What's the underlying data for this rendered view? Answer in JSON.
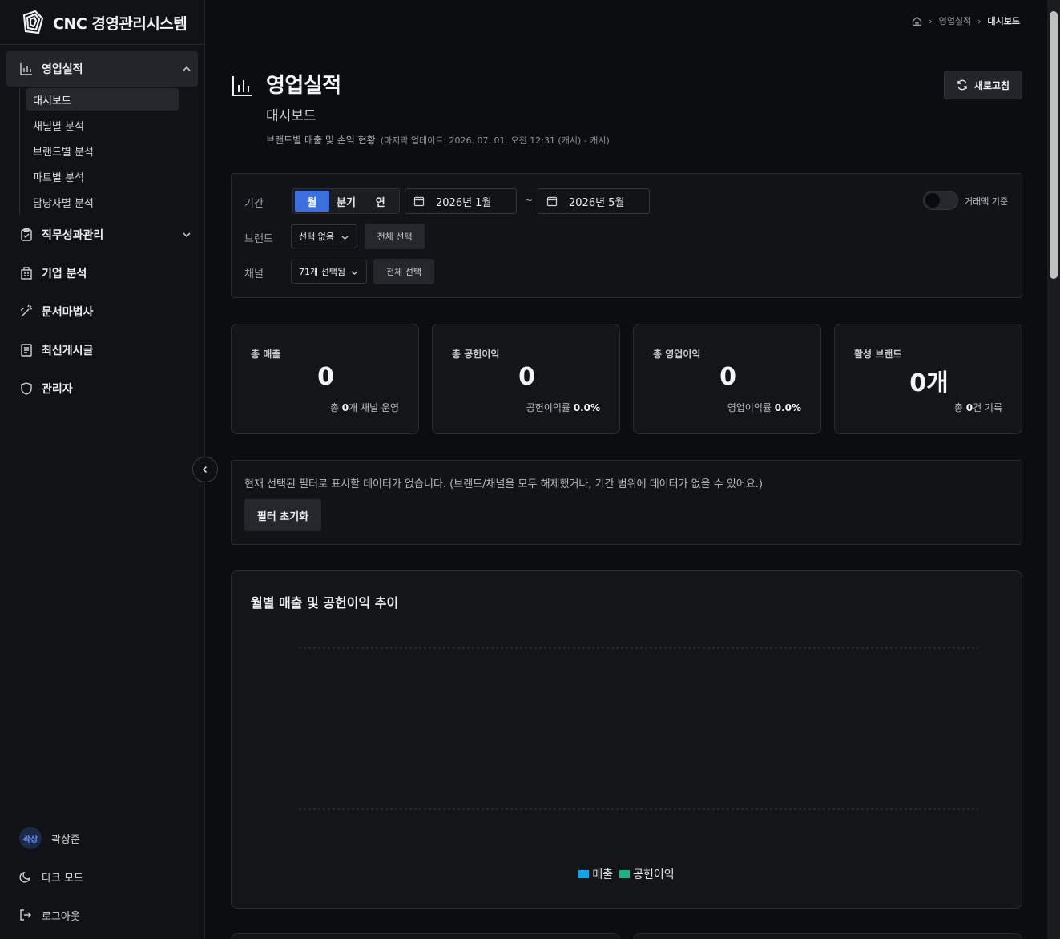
{
  "app": {
    "title": "CNC 경영관리시스템"
  },
  "sidebar": {
    "groups": [
      {
        "label": "영업실적",
        "icon": "bar-chart-icon"
      },
      {
        "label": "직무성과관리",
        "icon": "clipboard-icon"
      },
      {
        "label": "기업 분석",
        "icon": "building-icon"
      },
      {
        "label": "문서마법사",
        "icon": "magic-wand-icon"
      },
      {
        "label": "최신게시글",
        "icon": "newspaper-icon"
      },
      {
        "label": "관리자",
        "icon": "shield-icon"
      }
    ],
    "sub_items": [
      "대시보드",
      "채널별 분석",
      "브랜드별 분석",
      "파트별 분석",
      "담당자별 분석"
    ],
    "user": {
      "avatar": "곽상",
      "name": "곽상준"
    },
    "dark_mode": "다크 모드",
    "logout": "로그아웃"
  },
  "breadcrumb": {
    "parent": "영업실적",
    "current": "대시보드"
  },
  "page": {
    "title": "영업실적",
    "subtitle": "대시보드",
    "description": "브랜드별 매출 및 손익 현황",
    "meta": "(마지막 업데이트: 2026. 07. 01. 오전 12:31 (캐시) - 캐시)",
    "refresh": "새로고침"
  },
  "filters": {
    "period_label": "기간",
    "period_options": [
      "월",
      "분기",
      "연"
    ],
    "period_selected": "월",
    "start": "2026년 1월",
    "tilde": "~",
    "end": "2026년 5월",
    "toggle_label": "거래액 기준",
    "toggle_on": false,
    "brand_label": "브랜드",
    "brand_value": "선택 없음",
    "brand_select_all": "전체 선택",
    "channel_label": "채널",
    "channel_value": "71개 선택됨",
    "channel_select_all": "전체 선택"
  },
  "stats": [
    {
      "label": "총 매출",
      "value": "0",
      "foot_pre": "총 ",
      "foot_bold": "0",
      "foot_post": "개 채널 운영"
    },
    {
      "label": "총 공헌이익",
      "value": "0",
      "foot_pre": "공헌이익률 ",
      "foot_bold": "0.0%",
      "foot_post": ""
    },
    {
      "label": "총 영업이익",
      "value": "0",
      "foot_pre": "영업이익률 ",
      "foot_bold": "0.0%",
      "foot_post": ""
    },
    {
      "label": "활성 브랜드",
      "value": "0개",
      "foot_pre": "총 ",
      "foot_bold": "0",
      "foot_post": "건 기록"
    }
  ],
  "notice": {
    "text": "현재 선택된 필터로 표시할 데이터가 없습니다. (브랜드/채널을 모두 해제했거나, 기간 범위에 데이터가 없을 수 있어요.)",
    "reset": "필터 초기화"
  },
  "chart": {
    "title": "월별 매출 및 공헌이익 추이",
    "legend": [
      {
        "name": "매출",
        "color": "#0ea5e9"
      },
      {
        "name": "공헌이익",
        "color": "#10b981"
      }
    ]
  }
}
